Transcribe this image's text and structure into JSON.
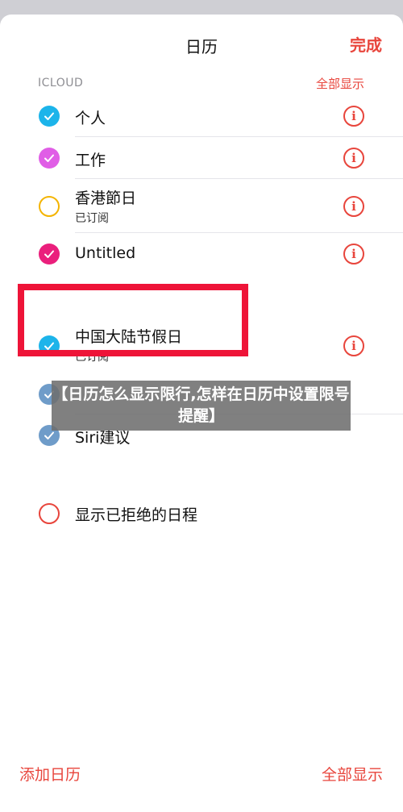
{
  "header": {
    "title": "日历",
    "done_label": "完成"
  },
  "icloud_section": {
    "label": "ICLOUD",
    "show_all_label": "全部显示",
    "items": [
      {
        "name": "个人",
        "subtitle": "",
        "color": "#1cb4ea",
        "checked": true
      },
      {
        "name": "工作",
        "subtitle": "",
        "color": "#e05ee6",
        "checked": true
      },
      {
        "name": "香港節日",
        "subtitle": "已订阅",
        "color": "#f4b400",
        "checked": false
      },
      {
        "name": "Untitled",
        "subtitle": "",
        "color": "#ea1f7c",
        "checked": true
      }
    ]
  },
  "other_section": {
    "items": [
      {
        "name": "中国大陆节假日",
        "subtitle": "已订阅",
        "color": "#1cb4ea",
        "checked": true
      },
      {
        "name": "",
        "subtitle": "",
        "color": "#6f9cc9",
        "checked": true
      },
      {
        "name": "Siri建议",
        "subtitle": "",
        "color": "#6f9cc9",
        "checked": true
      }
    ]
  },
  "declined": {
    "label": "显示已拒绝的日程",
    "color": "#e8453c",
    "checked": false
  },
  "overlay_text": "【日历怎么显示限行,怎样在日历中设置限号提醒】",
  "footer": {
    "add_calendar_label": "添加日历",
    "show_all_label": "全部显示"
  },
  "colors": {
    "accent": "#e8453c",
    "highlight_box": "#ee1438"
  }
}
